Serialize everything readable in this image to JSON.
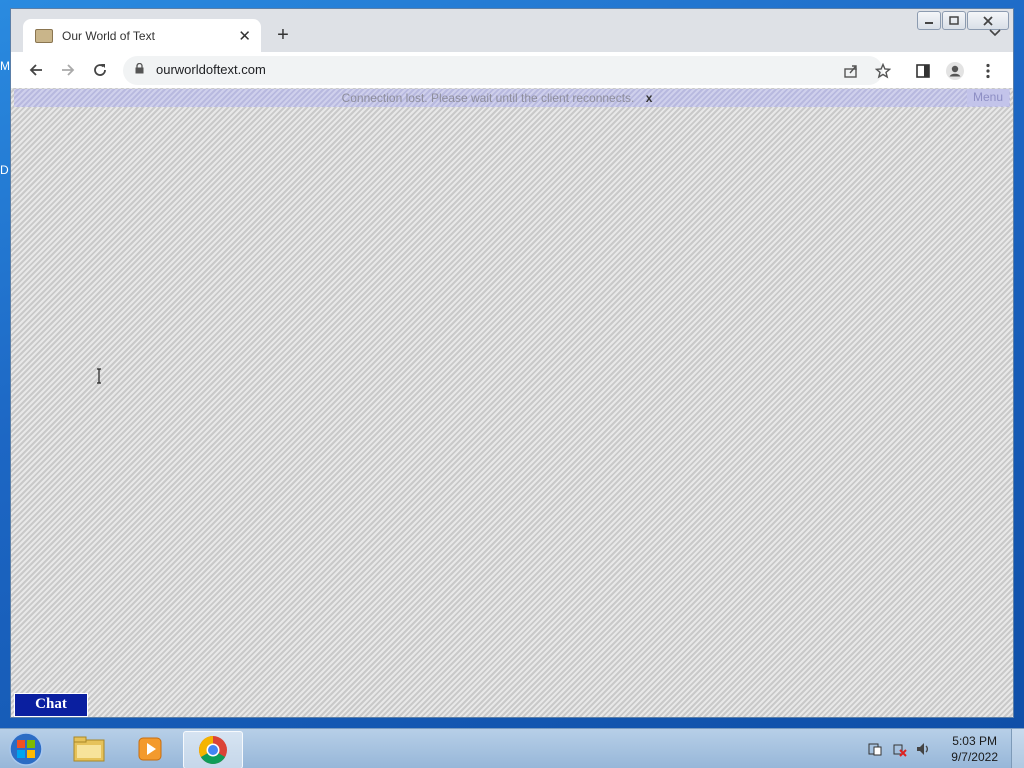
{
  "desktop": {
    "edge_labels": [
      "M",
      "D"
    ]
  },
  "browser": {
    "tab": {
      "title": "Our World of Text",
      "favicon": "owot-favicon-icon",
      "close_glyph": "✕"
    },
    "new_tab_glyph": "+",
    "address": {
      "url": "ourworldoftext.com"
    },
    "icons": [
      "back-icon",
      "forward-icon",
      "reload-icon",
      "lock-icon",
      "share-icon",
      "star-icon",
      "side-panel-icon",
      "profile-icon",
      "menu-dots-icon"
    ]
  },
  "page": {
    "banner": {
      "message": "Connection lost. Please wait until the client reconnects.",
      "dismiss": "x"
    },
    "menu_label": "Menu",
    "chat_label": "Chat"
  },
  "taskbar": {
    "apps": [
      "windows-start-icon",
      "file-explorer-icon",
      "media-player-icon",
      "chrome-icon"
    ],
    "clock": {
      "time": "5:03 PM",
      "date": "9/7/2022"
    }
  }
}
